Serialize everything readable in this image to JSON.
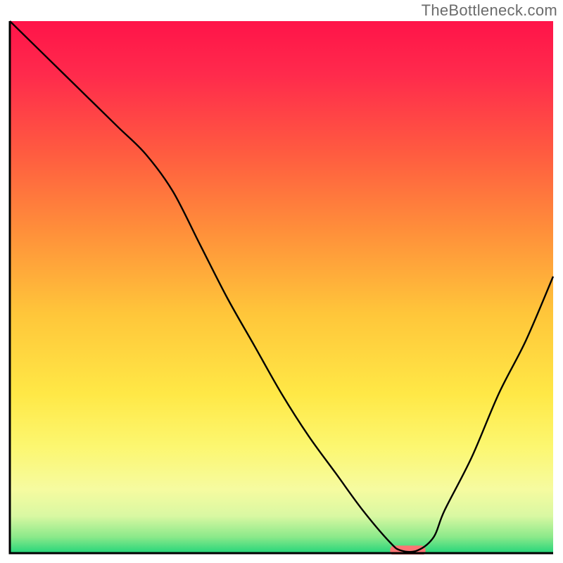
{
  "watermark": "TheBottleneck.com",
  "chart_data": {
    "type": "line",
    "title": "",
    "xlabel": "",
    "ylabel": "",
    "xlim": [
      0,
      100
    ],
    "ylim": [
      0,
      100
    ],
    "grid": false,
    "series": [
      {
        "name": "bottleneck-curve",
        "x": [
          0,
          5,
          10,
          15,
          20,
          25,
          30,
          35,
          40,
          45,
          50,
          55,
          60,
          65,
          70,
          72,
          75,
          78,
          80,
          85,
          90,
          95,
          100
        ],
        "values": [
          100,
          95,
          90,
          85,
          80,
          75,
          68,
          58,
          48,
          39,
          30,
          22,
          15,
          8,
          2,
          0.5,
          0.5,
          3,
          8,
          18,
          30,
          40,
          52
        ]
      }
    ],
    "markers": [
      {
        "name": "optimal-range-bar",
        "x0": 70,
        "x1": 76.5,
        "y": 0.5,
        "color": "#fc7474"
      }
    ],
    "background_gradient_stops": [
      {
        "offset": 0.0,
        "color": "#ff1449"
      },
      {
        "offset": 0.1,
        "color": "#ff2a4c"
      },
      {
        "offset": 0.25,
        "color": "#ff5c40"
      },
      {
        "offset": 0.4,
        "color": "#ff913a"
      },
      {
        "offset": 0.55,
        "color": "#ffc63a"
      },
      {
        "offset": 0.7,
        "color": "#ffe846"
      },
      {
        "offset": 0.8,
        "color": "#fcf770"
      },
      {
        "offset": 0.88,
        "color": "#f6fba0"
      },
      {
        "offset": 0.93,
        "color": "#d9f8a2"
      },
      {
        "offset": 0.97,
        "color": "#8ae98a"
      },
      {
        "offset": 1.0,
        "color": "#24d57a"
      }
    ],
    "axis_color": "#000000"
  }
}
